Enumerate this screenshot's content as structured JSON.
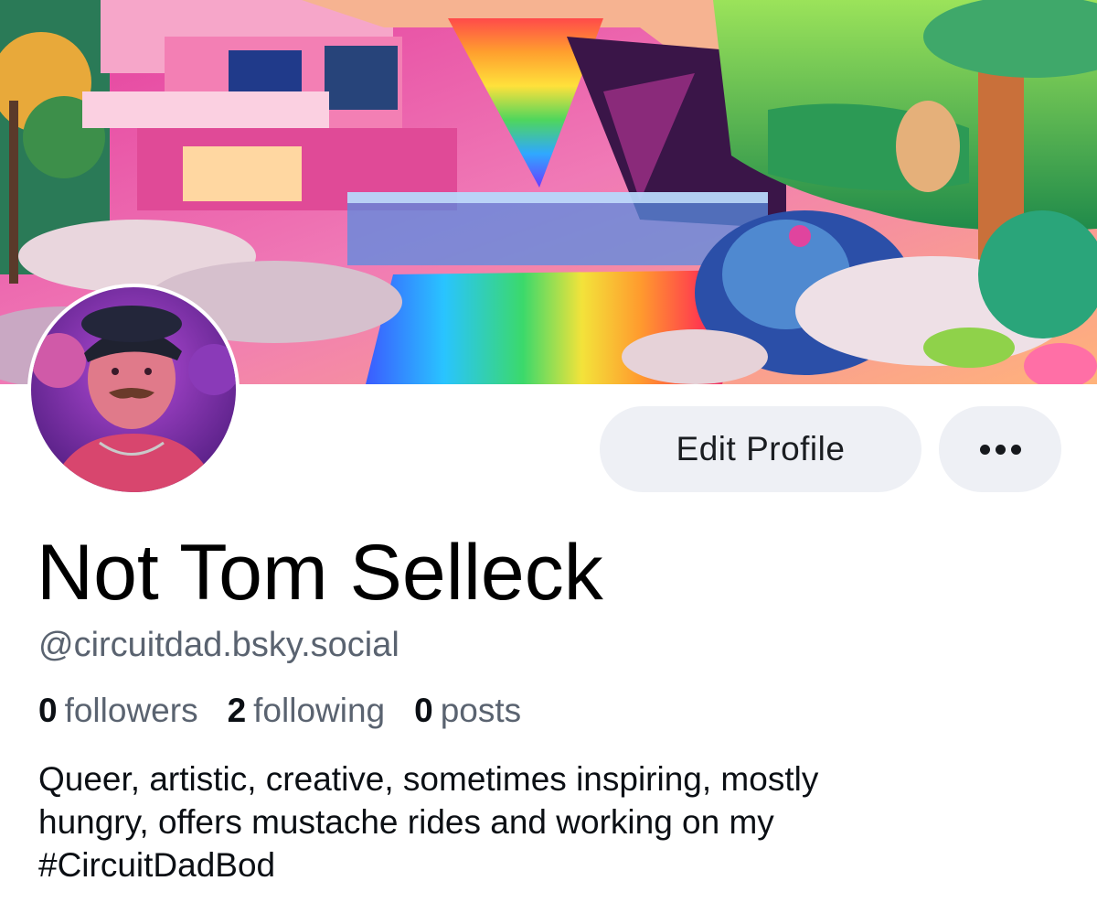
{
  "profile": {
    "display_name": "Not Tom Selleck",
    "handle": "@circuitdad.bsky.social",
    "bio_lines": [
      "Queer, artistic, creative, sometimes inspiring, mostly",
      "hungry, offers mustache rides and working on my",
      "#CircuitDadBod"
    ]
  },
  "stats": {
    "followers": {
      "count": "0",
      "label": "followers"
    },
    "following": {
      "count": "2",
      "label": "following"
    },
    "posts": {
      "count": "0",
      "label": "posts"
    }
  },
  "actions": {
    "edit_label": "Edit Profile",
    "more_icon": "ellipsis-icon"
  },
  "images": {
    "banner": "surreal rainbow waterfall house banner",
    "avatar": "profile photo"
  },
  "colors": {
    "button_bg": "#eef0f5",
    "secondary_text": "#5a6370",
    "primary_text": "#0b0f14"
  }
}
